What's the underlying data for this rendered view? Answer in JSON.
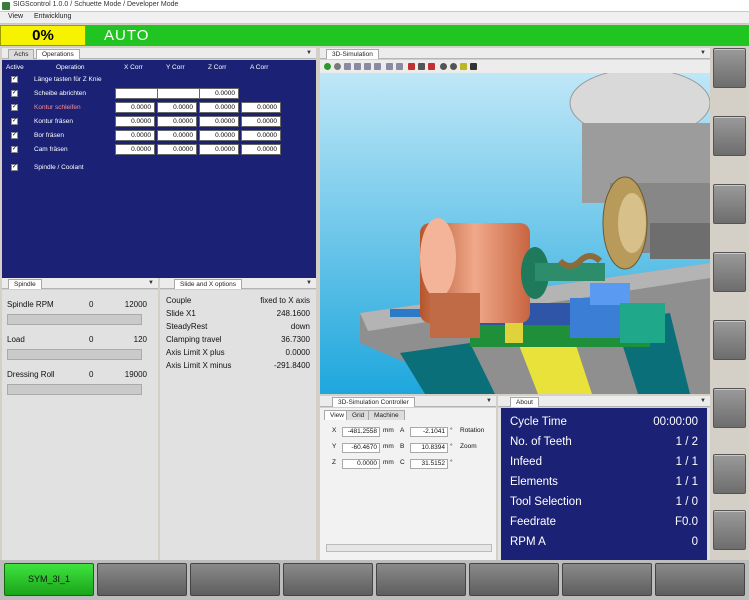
{
  "window": {
    "title": "SIGScontrol 1.0.0 / Schuette Mode / Developer Mode"
  },
  "menu": [
    "View",
    "Entwicklung"
  ],
  "status": {
    "progress": "0%",
    "mode": "AUTO",
    "progress_color": "#f7f200",
    "mode_color": "#21c521"
  },
  "operations_panel": {
    "tabs": [
      "Achs",
      "Operations"
    ],
    "headers": [
      "Active",
      "Operation",
      "X Corr",
      "Y Corr",
      "Z Corr",
      "A Corr"
    ],
    "rows": [
      {
        "active": true,
        "name": "Länge tasten für Z Knie",
        "values": []
      },
      {
        "active": true,
        "name": "Scheibe abrichten",
        "values": [
          "0.0000",
          "0.0000",
          "0.0000"
        ]
      },
      {
        "active": true,
        "name": "Kontur schleifen",
        "values": [
          "0.0000",
          "0.0000",
          "0.0000",
          "0.0000"
        ]
      },
      {
        "active": true,
        "name": "Kontur fräsen",
        "values": [
          "0.0000",
          "0.0000",
          "0.0000",
          "0.0000"
        ]
      },
      {
        "active": true,
        "name": "Bor fräsen",
        "values": [
          "0.0000",
          "0.0000",
          "0.0000",
          "0.0000"
        ]
      },
      {
        "active": true,
        "name": "Cam fräsen",
        "values": [
          "0.0000",
          "0.0000",
          "0.0000",
          "0.0000"
        ]
      },
      {
        "active": true,
        "name": "Spindle / Coolant",
        "values": []
      }
    ]
  },
  "spindle_panel": {
    "tab": "Spindle",
    "rows": [
      {
        "label": "Spindle RPM",
        "value": "0",
        "max": "12000"
      },
      {
        "label": "Load",
        "value": "0",
        "max": "120"
      },
      {
        "label": "Dressing Roll",
        "value": "0",
        "max": "19000"
      }
    ]
  },
  "slide_panel": {
    "tab": "Slide and X options",
    "rows": [
      {
        "label": "Couple",
        "value": "fixed to X axis"
      },
      {
        "label": "Slide X1",
        "value": "248.1600"
      },
      {
        "label": "SteadyRest",
        "value": "down"
      },
      {
        "label": "Clamping travel",
        "value": "36.7300"
      },
      {
        "label": "Axis Limit X plus",
        "value": "0.0000"
      },
      {
        "label": "Axis Limit X minus",
        "value": "-291.8400"
      }
    ]
  },
  "simulation_panel": {
    "tab": "3D-Simulation"
  },
  "sim_controller": {
    "tab": "3D-Simulation Controller",
    "subtabs": [
      "View",
      "Grid",
      "Machine"
    ],
    "rows": [
      {
        "axis": "X",
        "val": "-481.2558",
        "unit": "mm",
        "axis2": "A",
        "val2": "-2.1041",
        "unit2": "°",
        "action": "Rotation"
      },
      {
        "axis": "Y",
        "val": "-60.4670",
        "unit": "mm",
        "axis2": "B",
        "val2": "10.8394",
        "unit2": "°",
        "action": "Zoom"
      },
      {
        "axis": "Z",
        "val": "0.0000",
        "unit": "mm",
        "axis2": "C",
        "val2": "31.5152",
        "unit2": "°",
        "action": ""
      }
    ]
  },
  "about_panel": {
    "tab": "About",
    "rows": [
      {
        "label": "Cycle Time",
        "value": "00:00:00"
      },
      {
        "label": "No. of Teeth",
        "value": "1 / 2"
      },
      {
        "label": "Infeed",
        "value": "1 / 1"
      },
      {
        "label": "Elements",
        "value": "1 / 1"
      },
      {
        "label": "Tool Selection",
        "value": "1 / 0"
      },
      {
        "label": "Feedrate",
        "value": "F0.0"
      },
      {
        "label": "RPM A",
        "value": "0"
      }
    ]
  },
  "bottom_buttons": [
    "SYM_3I_1",
    "",
    "",
    "",
    "",
    "",
    "",
    ""
  ]
}
